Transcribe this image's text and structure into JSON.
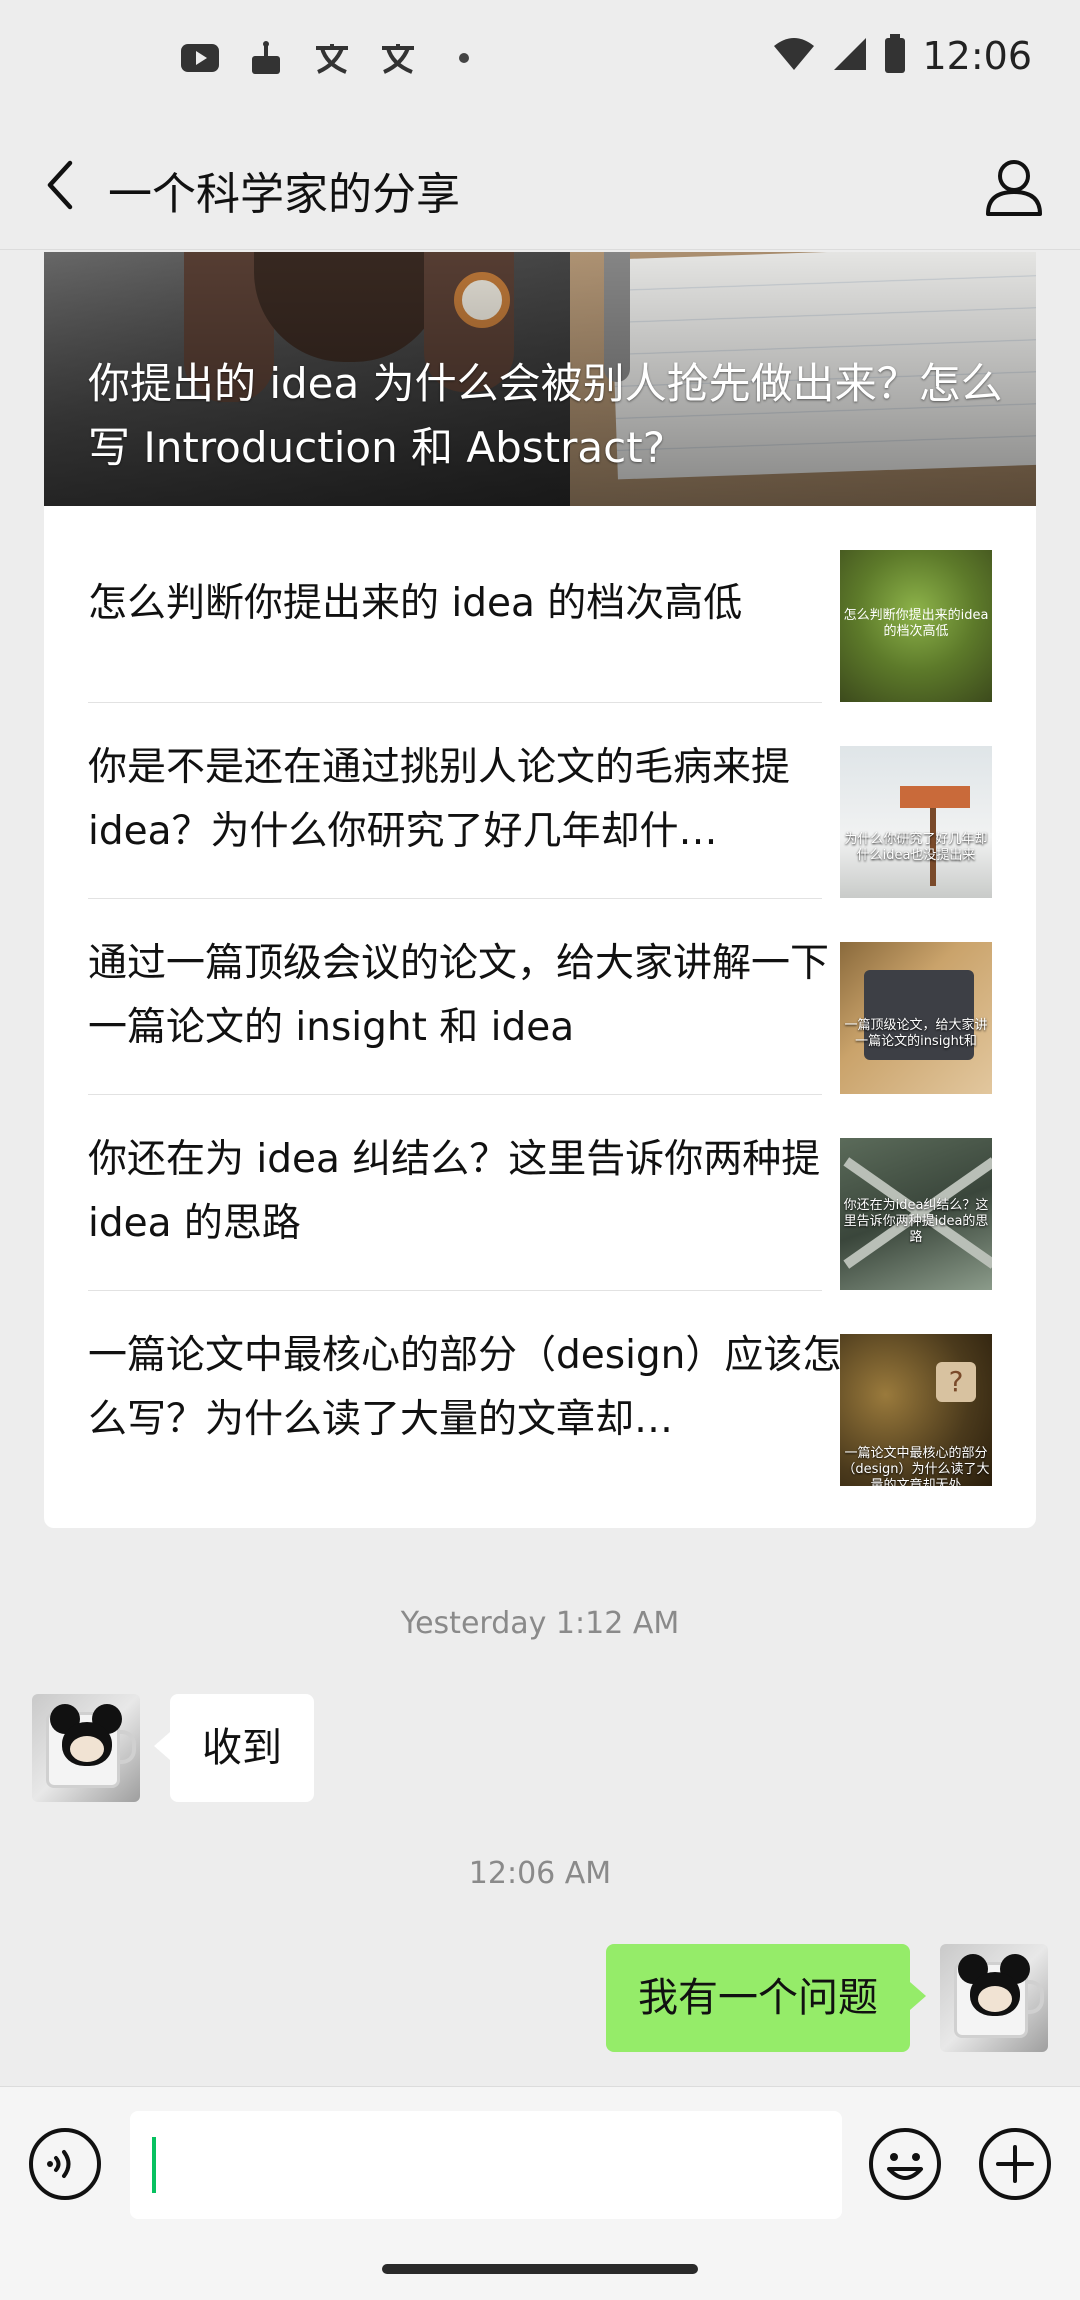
{
  "status_bar": {
    "time": "12:06",
    "left_icons": [
      "youtube-icon",
      "cake-icon",
      "translate-icon",
      "translate-icon",
      "dot-icon"
    ],
    "right_icons": [
      "wifi-icon",
      "signal-icon",
      "battery-icon"
    ]
  },
  "header": {
    "title": "一个科学家的分享",
    "back_icon": "chevron-left-icon",
    "profile_icon": "person-icon"
  },
  "article_card": {
    "hero_title": "你提出的 idea 为什么会被别人抢先做出来？怎么写 Introduction 和 Abstract?",
    "items": [
      {
        "title": "怎么判断你提出来的 idea 的档次高低",
        "thumb_caption": "怎么判断你提出来的idea的档次高低"
      },
      {
        "title": "你是不是还在通过挑别人论文的毛病来提 idea？为什么你研究了好几年却什…",
        "thumb_caption": "为什么你研究了好几年却什么idea也没提出来"
      },
      {
        "title": "通过一篇顶级会议的论文，给大家讲解一下一篇论文的 insight 和 idea",
        "thumb_caption": "一篇顶级论文，给大家讲一篇论文的insight和"
      },
      {
        "title": "你还在为 idea 纠结么？这里告诉你两种提 idea 的思路",
        "thumb_caption": "你还在为idea纠结么？这里告诉你两种提idea的思路"
      },
      {
        "title": "一篇论文中最核心的部分（design）应该怎么写？为什么读了大量的文章却…",
        "thumb_caption": "一篇论文中最核心的部分（design）为什么读了大量的文章却无处"
      }
    ]
  },
  "messages": [
    {
      "type": "timestamp",
      "text": "Yesterday 1:12 AM"
    },
    {
      "type": "incoming",
      "text": "收到"
    },
    {
      "type": "timestamp",
      "text": "12:06 AM"
    },
    {
      "type": "outgoing",
      "text": "我有一个问题"
    }
  ],
  "input_bar": {
    "value": "",
    "voice_icon": "voice-icon",
    "emoji_icon": "emoji-icon",
    "plus_icon": "plus-icon"
  },
  "colors": {
    "background": "#ededed",
    "outgoing_bubble": "#95ec69",
    "incoming_bubble": "#ffffff",
    "caret": "#07c160"
  }
}
